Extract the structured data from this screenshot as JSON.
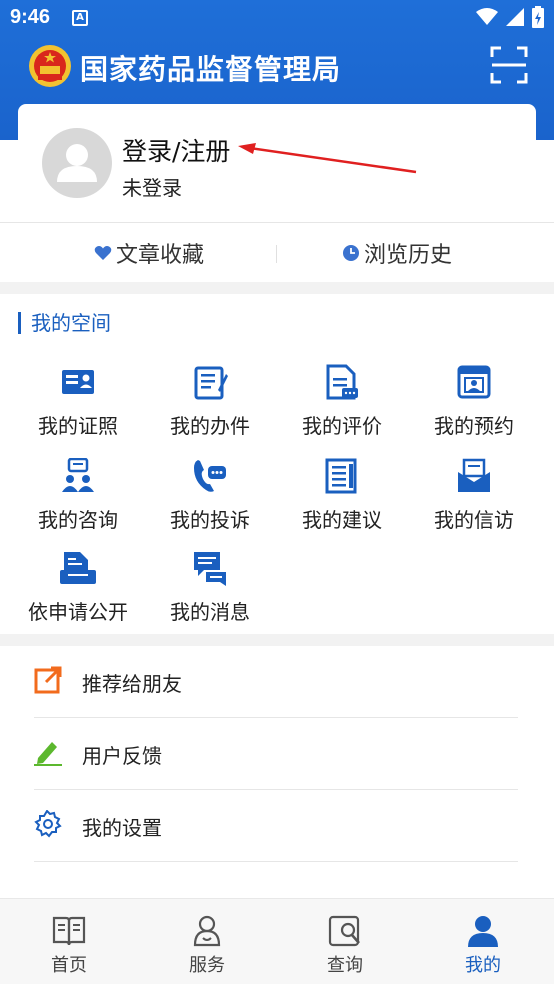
{
  "status_bar": {
    "time": "9:46",
    "notification_icon": "A"
  },
  "header": {
    "title": "国家药品监督管理局",
    "emblem_icon": "national-emblem-icon",
    "scan_icon": "scan-icon"
  },
  "profile": {
    "login_label": "登录/注册",
    "status": "未登录"
  },
  "quick_links": [
    {
      "label": "文章收藏",
      "icon": "heart-icon"
    },
    {
      "label": "浏览历史",
      "icon": "clock-icon"
    }
  ],
  "my_space": {
    "title": "我的空间",
    "items": [
      {
        "label": "我的证照",
        "icon": "license-card-icon"
      },
      {
        "label": "我的办件",
        "icon": "document-pen-icon"
      },
      {
        "label": "我的评价",
        "icon": "review-doc-icon"
      },
      {
        "label": "我的预约",
        "icon": "appointment-icon"
      },
      {
        "label": "我的咨询",
        "icon": "consult-icon"
      },
      {
        "label": "我的投诉",
        "icon": "complaint-phone-icon"
      },
      {
        "label": "我的建议",
        "icon": "suggestion-icon"
      },
      {
        "label": "我的信访",
        "icon": "letter-icon"
      },
      {
        "label": "依申请公开",
        "icon": "disclosure-icon"
      },
      {
        "label": "我的消息",
        "icon": "message-icon"
      }
    ]
  },
  "settings_list": [
    {
      "label": "推荐给朋友",
      "icon": "share-icon",
      "color": "#f26b1d"
    },
    {
      "label": "用户反馈",
      "icon": "pencil-icon",
      "color": "#5cb82e"
    },
    {
      "label": "我的设置",
      "icon": "gear-icon",
      "color": "#1a5fbf"
    }
  ],
  "bottom_nav": [
    {
      "label": "首页",
      "icon": "book-icon",
      "active": false
    },
    {
      "label": "服务",
      "icon": "service-icon",
      "active": false
    },
    {
      "label": "查询",
      "icon": "search-icon",
      "active": false
    },
    {
      "label": "我的",
      "icon": "user-icon",
      "active": true
    }
  ],
  "colors": {
    "brand_blue": "#1a63cc",
    "accent_blue": "#1a5fbf",
    "annotation_red": "#e02020"
  }
}
